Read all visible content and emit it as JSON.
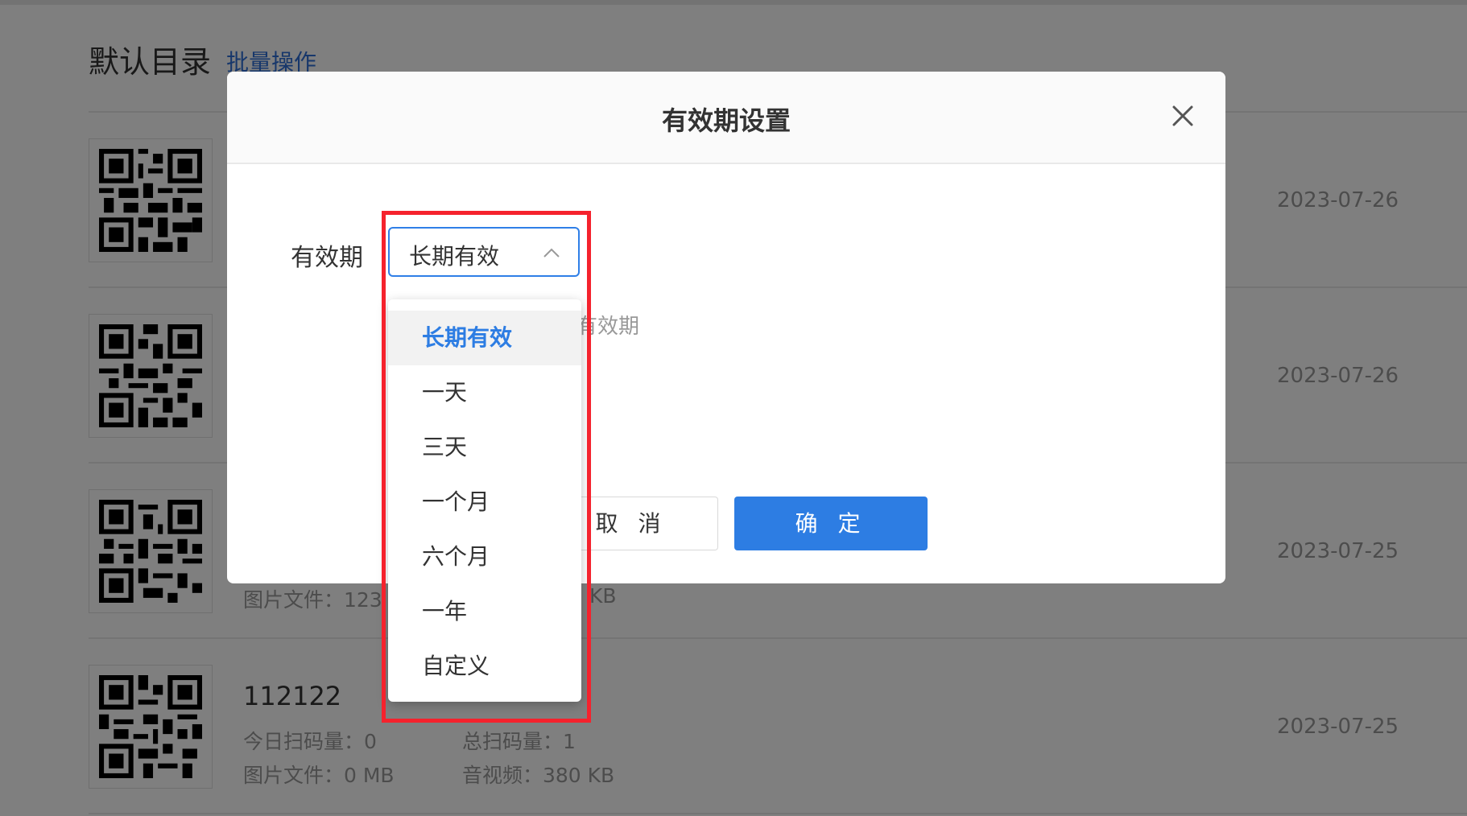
{
  "header": {
    "title": "默认目录",
    "batch_link": "批量操作"
  },
  "list": [
    {
      "date": "2023-07-26"
    },
    {
      "date": "2023-07-26"
    },
    {
      "date": "2023-07-25",
      "image_files": "图片文件：123",
      "av_size": "KB"
    },
    {
      "date": "2023-07-25",
      "title": "112122",
      "today_scans": "今日扫码量：0",
      "total_scans": "总扫码量：1",
      "image_files": "图片文件：0 MB",
      "audio_video": "音视频：380 KB"
    }
  ],
  "modal": {
    "title": "有效期设置",
    "close_icon": "close-icon",
    "field_label": "有效期",
    "select_value": "长期有效",
    "hint_fragment": "有效期",
    "cancel_label": "取 消",
    "ok_label": "确 定"
  },
  "dropdown": {
    "options": [
      {
        "label": "长期有效",
        "selected": true
      },
      {
        "label": "一天"
      },
      {
        "label": "三天"
      },
      {
        "label": "一个月"
      },
      {
        "label": "六个月"
      },
      {
        "label": "一年"
      },
      {
        "label": "自定义"
      }
    ]
  },
  "colors": {
    "primary": "#2d7de3",
    "highlight": "#f5222d",
    "overlay": "rgba(0,0,0,0.5)"
  }
}
